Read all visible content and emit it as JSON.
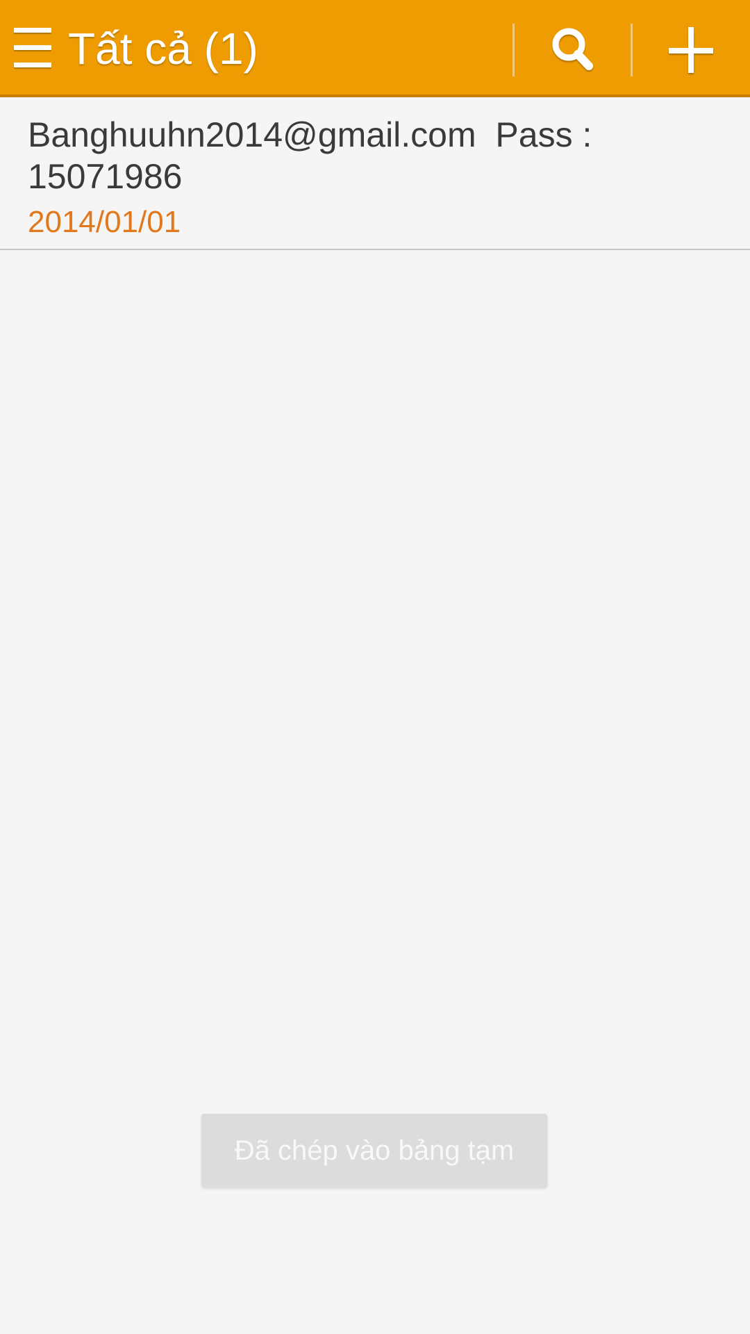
{
  "colors": {
    "action_bar": "#ee9c02",
    "background": "#f5f5f5",
    "date_accent": "#e1791c",
    "toast_bg": "#dcdcdc"
  },
  "action_bar": {
    "menu_icon": "menu-icon",
    "title": "Tất cả (1)",
    "search_icon": "search-icon",
    "add_icon": "plus-icon"
  },
  "notes": [
    {
      "title": "Banghuuhn2014@gmail.com  Pass :\n15071986",
      "date": "2014/01/01"
    }
  ],
  "toast": {
    "message": "Đã chép vào bảng tạm"
  }
}
